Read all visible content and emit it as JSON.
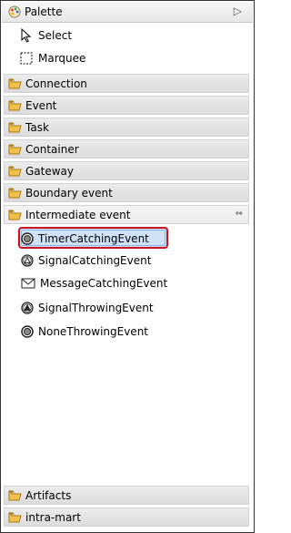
{
  "palette": {
    "title": "Palette",
    "collapse_arrow": "▷"
  },
  "tools": [
    {
      "label": "Select",
      "icon": "select-cursor-icon"
    },
    {
      "label": "Marquee",
      "icon": "marquee-icon"
    }
  ],
  "drawers": [
    {
      "label": "Connection"
    },
    {
      "label": "Event"
    },
    {
      "label": "Task"
    },
    {
      "label": "Container"
    },
    {
      "label": "Gateway"
    },
    {
      "label": "Boundary event"
    },
    {
      "label": "Intermediate event",
      "open": true,
      "pin": "⇔"
    },
    {
      "label": "Artifacts"
    },
    {
      "label": "intra-mart"
    }
  ],
  "intermediate_entries": [
    {
      "label": "TimerCatchingEvent",
      "icon": "timer-catching-event-icon",
      "selected": true
    },
    {
      "label": "SignalCatchingEvent",
      "icon": "signal-catching-event-icon"
    },
    {
      "label": "MessageCatchingEvent",
      "icon": "message-catching-event-icon"
    },
    {
      "label": "SignalThrowingEvent",
      "icon": "signal-throwing-event-icon"
    },
    {
      "label": "NoneThrowingEvent",
      "icon": "none-throwing-event-icon"
    }
  ],
  "colors": {
    "selection_border": "#c8121d",
    "selection_fill": "#cfe1f7",
    "folder": "#f0c04a"
  }
}
